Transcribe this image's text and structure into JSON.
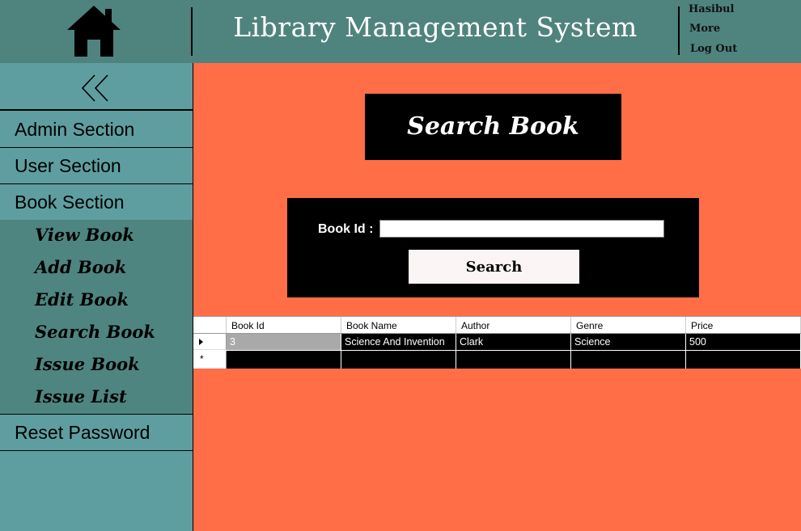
{
  "header": {
    "title": "Library Management System",
    "user_name": "Hasibul",
    "more_label": "More",
    "logout_label": "Log Out",
    "home_icon": "home-icon"
  },
  "sidebar": {
    "collapse_icon": "double-chevron-left-icon",
    "sections": [
      {
        "label": "Admin Section"
      },
      {
        "label": "User Section"
      },
      {
        "label": "Book Section"
      }
    ],
    "book_items": [
      {
        "label": "View Book"
      },
      {
        "label": "Add Book"
      },
      {
        "label": "Edit Book"
      },
      {
        "label": "Search Book"
      },
      {
        "label": "Issue Book"
      },
      {
        "label": "Issue List"
      }
    ],
    "reset_label": "Reset Password"
  },
  "main": {
    "page_title": "Search Book",
    "book_id_label": "Book Id :",
    "book_id_value": "",
    "search_button": "Search"
  },
  "grid": {
    "columns": [
      "Book Id",
      "Book Name",
      "Author",
      "Genre",
      "Price"
    ],
    "rows": [
      [
        "3",
        "Science And Invention",
        "Clark",
        "Science",
        "500"
      ]
    ],
    "new_row_marker": "*"
  },
  "colors": {
    "header_bg": "#4f837e",
    "sidebar_bg": "#5f9ea0",
    "submenu_bg": "#4e8580",
    "main_bg": "#ff6e47",
    "panel_bg": "#000000"
  }
}
